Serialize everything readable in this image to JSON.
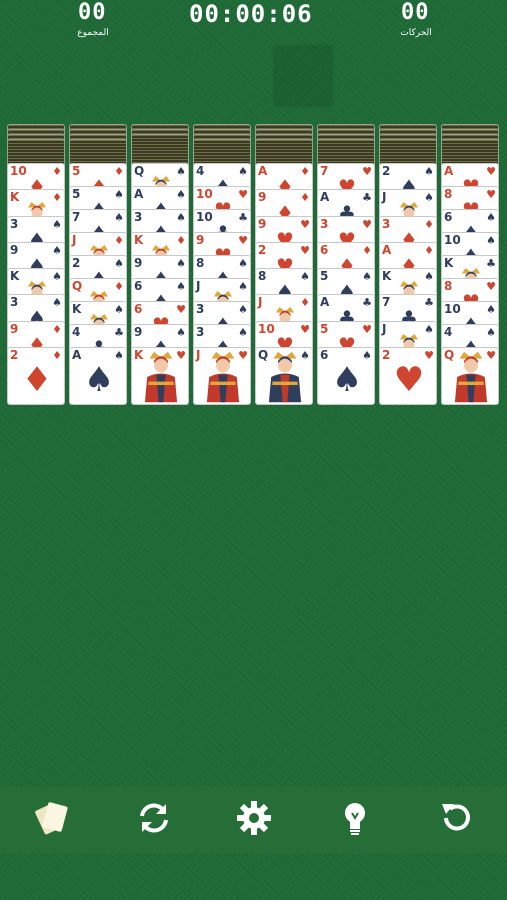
{
  "hud": {
    "score_value": "00",
    "score_label": "المجموع",
    "timer": "00:00:06",
    "moves_value": "00",
    "moves_label": "الحركات"
  },
  "colors": {
    "felt": "#1e6a36",
    "red_suit": "#d0452f",
    "black_suit": "#2e3e5c",
    "toolbar": "#286e37"
  },
  "piles": [
    {
      "facedown": 4,
      "cards": [
        {
          "rank": "10",
          "suit": "diamond"
        },
        {
          "rank": "K",
          "suit": "diamond"
        },
        {
          "rank": "3",
          "suit": "spade"
        },
        {
          "rank": "9",
          "suit": "spade"
        },
        {
          "rank": "K",
          "suit": "spade"
        },
        {
          "rank": "3",
          "suit": "spade"
        },
        {
          "rank": "9",
          "suit": "diamond"
        },
        {
          "rank": "2",
          "suit": "diamond"
        }
      ]
    },
    {
      "facedown": 4,
      "cards": [
        {
          "rank": "5",
          "suit": "diamond"
        },
        {
          "rank": "5",
          "suit": "spade"
        },
        {
          "rank": "7",
          "suit": "spade"
        },
        {
          "rank": "J",
          "suit": "diamond"
        },
        {
          "rank": "2",
          "suit": "spade"
        },
        {
          "rank": "Q",
          "suit": "diamond"
        },
        {
          "rank": "K",
          "suit": "spade"
        },
        {
          "rank": "4",
          "suit": "club"
        },
        {
          "rank": "A",
          "suit": "spade"
        }
      ]
    },
    {
      "facedown": 3,
      "cards": [
        {
          "rank": "Q",
          "suit": "spade"
        },
        {
          "rank": "A",
          "suit": "spade"
        },
        {
          "rank": "3",
          "suit": "spade"
        },
        {
          "rank": "K",
          "suit": "diamond"
        },
        {
          "rank": "9",
          "suit": "spade"
        },
        {
          "rank": "6",
          "suit": "spade"
        },
        {
          "rank": "6",
          "suit": "heart"
        },
        {
          "rank": "9",
          "suit": "spade"
        },
        {
          "rank": "K",
          "suit": "heart"
        }
      ]
    },
    {
      "facedown": 4,
      "cards": [
        {
          "rank": "4",
          "suit": "spade"
        },
        {
          "rank": "10",
          "suit": "heart"
        },
        {
          "rank": "10",
          "suit": "club"
        },
        {
          "rank": "9",
          "suit": "heart"
        },
        {
          "rank": "8",
          "suit": "spade"
        },
        {
          "rank": "J",
          "suit": "spade"
        },
        {
          "rank": "3",
          "suit": "spade"
        },
        {
          "rank": "3",
          "suit": "spade"
        },
        {
          "rank": "J",
          "suit": "heart"
        }
      ]
    },
    {
      "facedown": 4,
      "cards": [
        {
          "rank": "A",
          "suit": "diamond"
        },
        {
          "rank": "9",
          "suit": "diamond"
        },
        {
          "rank": "9",
          "suit": "heart"
        },
        {
          "rank": "2",
          "suit": "heart"
        },
        {
          "rank": "8",
          "suit": "spade"
        },
        {
          "rank": "J",
          "suit": "diamond"
        },
        {
          "rank": "10",
          "suit": "heart"
        },
        {
          "rank": "Q",
          "suit": "spade"
        }
      ]
    },
    {
      "facedown": 4,
      "cards": [
        {
          "rank": "7",
          "suit": "heart"
        },
        {
          "rank": "A",
          "suit": "club"
        },
        {
          "rank": "3",
          "suit": "heart"
        },
        {
          "rank": "6",
          "suit": "diamond"
        },
        {
          "rank": "5",
          "suit": "spade"
        },
        {
          "rank": "A",
          "suit": "club"
        },
        {
          "rank": "5",
          "suit": "heart"
        },
        {
          "rank": "6",
          "suit": "spade"
        }
      ]
    },
    {
      "facedown": 4,
      "cards": [
        {
          "rank": "2",
          "suit": "spade"
        },
        {
          "rank": "J",
          "suit": "spade"
        },
        {
          "rank": "3",
          "suit": "diamond"
        },
        {
          "rank": "A",
          "suit": "diamond"
        },
        {
          "rank": "K",
          "suit": "spade"
        },
        {
          "rank": "7",
          "suit": "club"
        },
        {
          "rank": "J",
          "suit": "spade"
        },
        {
          "rank": "2",
          "suit": "heart"
        }
      ]
    },
    {
      "facedown": 4,
      "cards": [
        {
          "rank": "A",
          "suit": "heart"
        },
        {
          "rank": "8",
          "suit": "heart"
        },
        {
          "rank": "6",
          "suit": "spade"
        },
        {
          "rank": "10",
          "suit": "spade"
        },
        {
          "rank": "K",
          "suit": "club"
        },
        {
          "rank": "8",
          "suit": "heart"
        },
        {
          "rank": "10",
          "suit": "spade"
        },
        {
          "rank": "4",
          "suit": "spade"
        },
        {
          "rank": "Q",
          "suit": "heart"
        }
      ]
    }
  ],
  "toolbar": [
    {
      "name": "cards-deck-icon"
    },
    {
      "name": "refresh-icon"
    },
    {
      "name": "gear-icon"
    },
    {
      "name": "lightbulb-icon"
    },
    {
      "name": "undo-icon"
    }
  ]
}
